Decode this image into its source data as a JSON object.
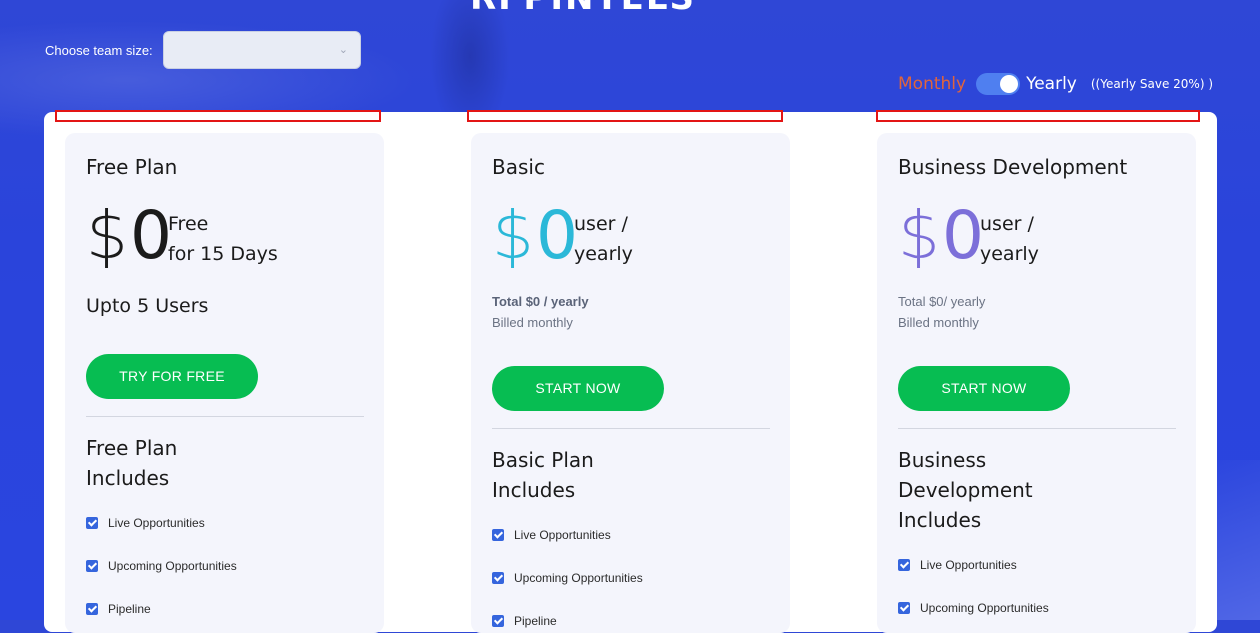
{
  "brand": {
    "logo_text": "RFPINTELS"
  },
  "team_size": {
    "label": "Choose team size:",
    "value": ""
  },
  "billing": {
    "monthly_label": "Monthly",
    "yearly_label": "Yearly",
    "save_label": "((Yearly Save 20%) )",
    "selected": "Yearly"
  },
  "plans": [
    {
      "name": "Free Plan",
      "currency": "$",
      "amount": "0",
      "unit_line1": "Free",
      "unit_line2": "for 15 Days",
      "users": "Upto 5 Users",
      "cta": "TRY FOR FREE",
      "includes_title": "Free Plan Includes",
      "features": [
        "Live Opportunities",
        "Upcoming Opportunities",
        "Pipeline"
      ]
    },
    {
      "name": "Basic",
      "currency": "$",
      "amount": "0",
      "unit_line1": "user /",
      "unit_line2": "yearly",
      "total": "Total $0 / yearly",
      "billed": "Billed monthly",
      "cta": "START NOW",
      "includes_title": "Basic Plan Includes",
      "features": [
        "Live Opportunities",
        "Upcoming Opportunities",
        "Pipeline"
      ]
    },
    {
      "name": "Business Development",
      "currency": "$",
      "amount": "0",
      "unit_line1": "user /",
      "unit_line2": "yearly",
      "total": "Total $0/ yearly",
      "billed": "Billed monthly",
      "cta": "START NOW",
      "includes_title": "Business Development Includes",
      "features": [
        "Live Opportunities",
        "Upcoming Opportunities"
      ]
    }
  ],
  "colors": {
    "background": "#2a45e0",
    "cta": "#07bd52",
    "price_basic": "#2bb8d8",
    "price_business": "#7c6fd9",
    "price_free": "#1b1b1b",
    "monthly": "#e0643c",
    "highlight_box": "#e31515"
  }
}
